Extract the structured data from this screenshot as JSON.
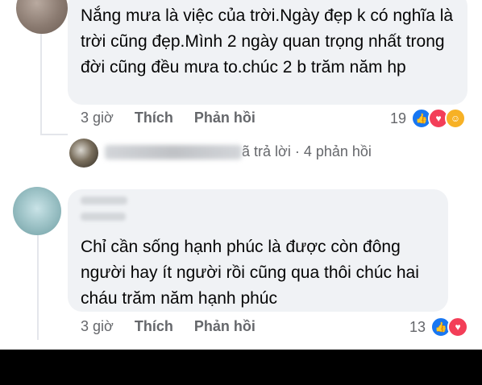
{
  "comment_1": {
    "text": "Nắng mưa là việc của trời.Ngày đẹp k có nghĩa là trời cũng đẹp.Mình 2 ngày quan trọng nhất trong đời cũng đều mưa to.chúc 2 b trăm năm hp",
    "time": "3 giờ",
    "like_label": "Thích",
    "reply_label": "Phản hồi",
    "reaction_count": "19",
    "reactions": [
      "like-icon",
      "love-icon",
      "haha-icon"
    ]
  },
  "reply_summary": {
    "text": "ã trả lời · 4 phản hồi"
  },
  "comment_2": {
    "text": "Chỉ cần sống hạnh phúc là được còn đông người hay ít người rồi cũng qua thôi chúc hai cháu trăm năm hạnh phúc",
    "time": "3 giờ",
    "like_label": "Thích",
    "reply_label": "Phản hồi",
    "reaction_count": "13",
    "reactions": [
      "like-icon",
      "love-icon"
    ]
  },
  "colors": {
    "bubble": "#f0f2f5",
    "meta_text": "#65676b",
    "like": "#1877f2",
    "love": "#f33e58",
    "haha": "#f7b125"
  }
}
